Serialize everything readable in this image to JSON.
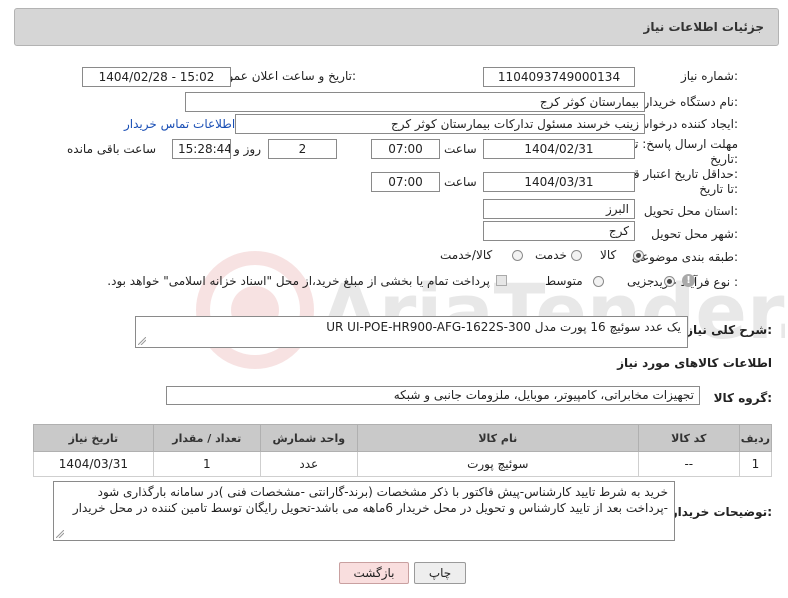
{
  "header": {
    "title": "جزئیات اطلاعات نیاز"
  },
  "form": {
    "need_number_label": "شماره نیاز:",
    "need_number": "1104093749000134",
    "announce_label": "تاریخ و ساعت اعلان عمومی:",
    "announce_value": "1404/02/28 - 15:02",
    "buyer_label": "نام دستگاه خریدار:",
    "buyer_value": "بیمارستان کوثر کرج",
    "creator_label": "ایجاد کننده درخواست:",
    "creator_value": "زینب خرسند مسئول تدارکات بیمارستان کوثر کرج",
    "contact_link": "اطلاعات تماس خریدار",
    "deadline_label_1": "مهلت ارسال پاسخ: تا",
    "deadline_label_2": "تاریخ:",
    "deadline_date": "1404/02/31",
    "time_label": "ساعت",
    "deadline_time": "07:00",
    "days_value": "2",
    "days_label": "روز و",
    "remaining_time": "15:28:44",
    "remaining_label": "ساعت باقی مانده",
    "validity_label_1": "حداقل تاریخ اعتبار قیمت:",
    "validity_label_2": "تا تاریخ:",
    "validity_date": "1404/03/31",
    "validity_time_label": "ساعت",
    "validity_time": "07:00",
    "province_label": "استان محل تحویل:",
    "province_value": "البرز",
    "city_label": "شهر محل تحویل:",
    "city_value": "کرج",
    "category_label": "طبقه بندی موضوعی:",
    "category_options": [
      "کالا",
      "خدمت",
      "کالا/خدمت"
    ],
    "category_selected": "کالا",
    "process_label": "نوع فرآیند خرید :",
    "process_options": [
      "جزیی",
      "متوسط"
    ],
    "process_selected": "جزیی",
    "payment_note": "پرداخت تمام یا بخشی از مبلغ خرید،از محل \"اسناد خزانه اسلامی\" خواهد بود."
  },
  "description": {
    "label": "شرح کلی نیاز:",
    "value": "یک عدد سوئیچ  16 پورت مدل UR UI-POE-HR900-AFG-1622S-300"
  },
  "goods": {
    "section_title": "اطلاعات کالاهای مورد نیاز",
    "group_label": "گروه کالا:",
    "group_value": "تجهیزات مخابراتی، کامپیوتر، موبایل، ملزومات جانبی و شبکه",
    "columns": [
      "ردیف",
      "کد کالا",
      "نام کالا",
      "واحد شمارش",
      "تعداد / مقدار",
      "تاریخ نیاز"
    ],
    "rows": [
      [
        "1",
        "--",
        "سوئیچ پورت",
        "عدد",
        "1",
        "1404/03/31"
      ]
    ]
  },
  "buyer_notes": {
    "label": "توضیحات خریدار:",
    "value": "خرید به شرط تایید کارشناس-پیش فاکتور با ذکر مشخصات (برند-گارانتی -مشخصات فنی )در سامانه بارگذاری شود -پرداخت بعد از تایید کارشناس و تحویل در محل خریدار 6ماهه می باشد-تحویل رایگان توسط تامین کننده در محل خریدار"
  },
  "buttons": {
    "print": "چاپ",
    "back": "بازگشت"
  },
  "watermark": {
    "text": "AriaTender.neT"
  },
  "colors": {
    "link": "#1a4fb5",
    "header_bg": "#d6d6d6",
    "table_header_bg": "#c9c9c9",
    "back_button_bg": "#f9dede"
  }
}
